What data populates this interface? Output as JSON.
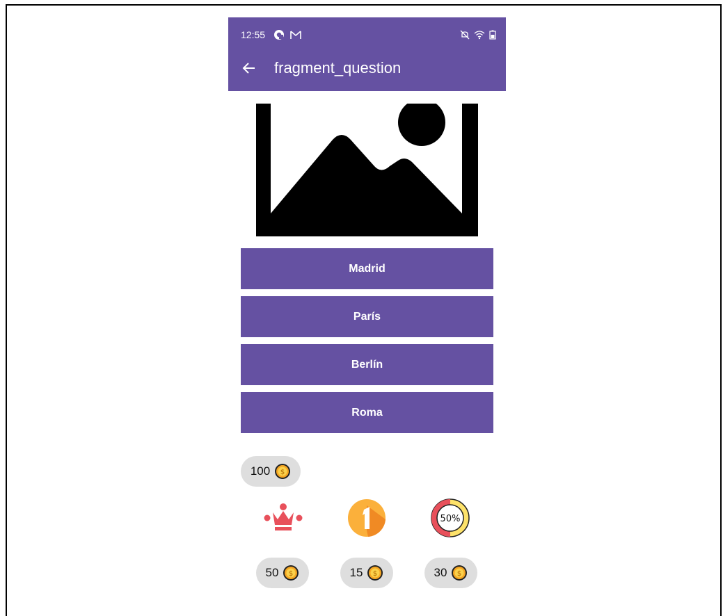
{
  "status_bar": {
    "time": "12:55",
    "icons": [
      "pocket-casts-icon",
      "gmail-icon",
      "mute-icon",
      "wifi-icon",
      "battery-icon"
    ]
  },
  "toolbar": {
    "title": "fragment_question",
    "back_icon": "arrow-left-icon"
  },
  "question_image": {
    "icon": "image-placeholder-icon"
  },
  "answers": [
    "Madrid",
    "París",
    "Berlín",
    "Roma"
  ],
  "coins": {
    "total": "100"
  },
  "powerups": [
    {
      "name": "crown",
      "icon": "crown-icon",
      "cost": "50"
    },
    {
      "name": "number-one",
      "icon": "number-one-icon",
      "cost": "15"
    },
    {
      "name": "fifty-percent",
      "icon": "fifty-percent-icon",
      "cost": "30",
      "icon_text": "50%"
    }
  ],
  "colors": {
    "primary": "#6551a2",
    "pill": "#dedede",
    "coin": "#f5a623",
    "crown": "#e8505b"
  }
}
